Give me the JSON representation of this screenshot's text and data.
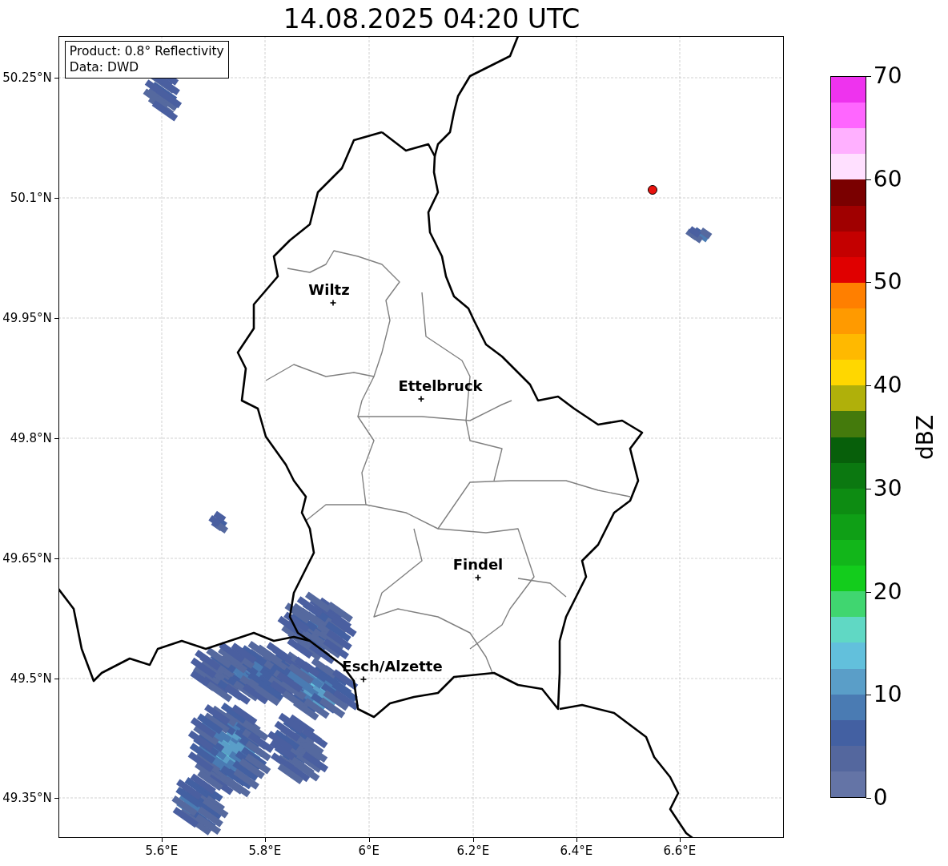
{
  "title": "14.08.2025 04:20 UTC",
  "legend": {
    "lines": [
      "Product: 0.8° Reflectivity",
      "Data: DWD"
    ]
  },
  "map": {
    "lat_ticks": [
      "50.25°N",
      "50.1°N",
      "49.95°N",
      "49.8°N",
      "49.65°N",
      "49.5°N",
      "49.35°N"
    ],
    "lon_ticks": [
      "5.6°E",
      "5.8°E",
      "6°E",
      "6.2°E",
      "6.4°E",
      "6.6°E"
    ],
    "places": [
      {
        "name": "Wiltz"
      },
      {
        "name": "Ettelbruck"
      },
      {
        "name": "Findel"
      },
      {
        "name": "Esch/Alzette"
      }
    ]
  },
  "colorbar": {
    "label": "dBZ",
    "ticks": [
      "70",
      "60",
      "50",
      "40",
      "30",
      "20",
      "10",
      "0"
    ],
    "bins": [
      {
        "color": "#ee33ee"
      },
      {
        "color": "#ff66ff"
      },
      {
        "color": "#ffb0ff"
      },
      {
        "color": "#ffe0ff"
      },
      {
        "color": "#7a0000"
      },
      {
        "color": "#a00000"
      },
      {
        "color": "#c40000"
      },
      {
        "color": "#e00000"
      },
      {
        "color": "#ff7f00"
      },
      {
        "color": "#ff9a00"
      },
      {
        "color": "#ffb900"
      },
      {
        "color": "#ffd700"
      },
      {
        "color": "#b0b00a"
      },
      {
        "color": "#447a0c"
      },
      {
        "color": "#075f0a"
      },
      {
        "color": "#0b7810"
      },
      {
        "color": "#0d8c12"
      },
      {
        "color": "#0f9f16"
      },
      {
        "color": "#12b61a"
      },
      {
        "color": "#13cc1c"
      },
      {
        "color": "#40d670"
      },
      {
        "color": "#60d8c4"
      },
      {
        "color": "#62c0dc"
      },
      {
        "color": "#5a9ec8"
      },
      {
        "color": "#4a7bb3"
      },
      {
        "color": "#4360a2"
      },
      {
        "color": "#54679e"
      },
      {
        "color": "#6474a6"
      }
    ]
  }
}
